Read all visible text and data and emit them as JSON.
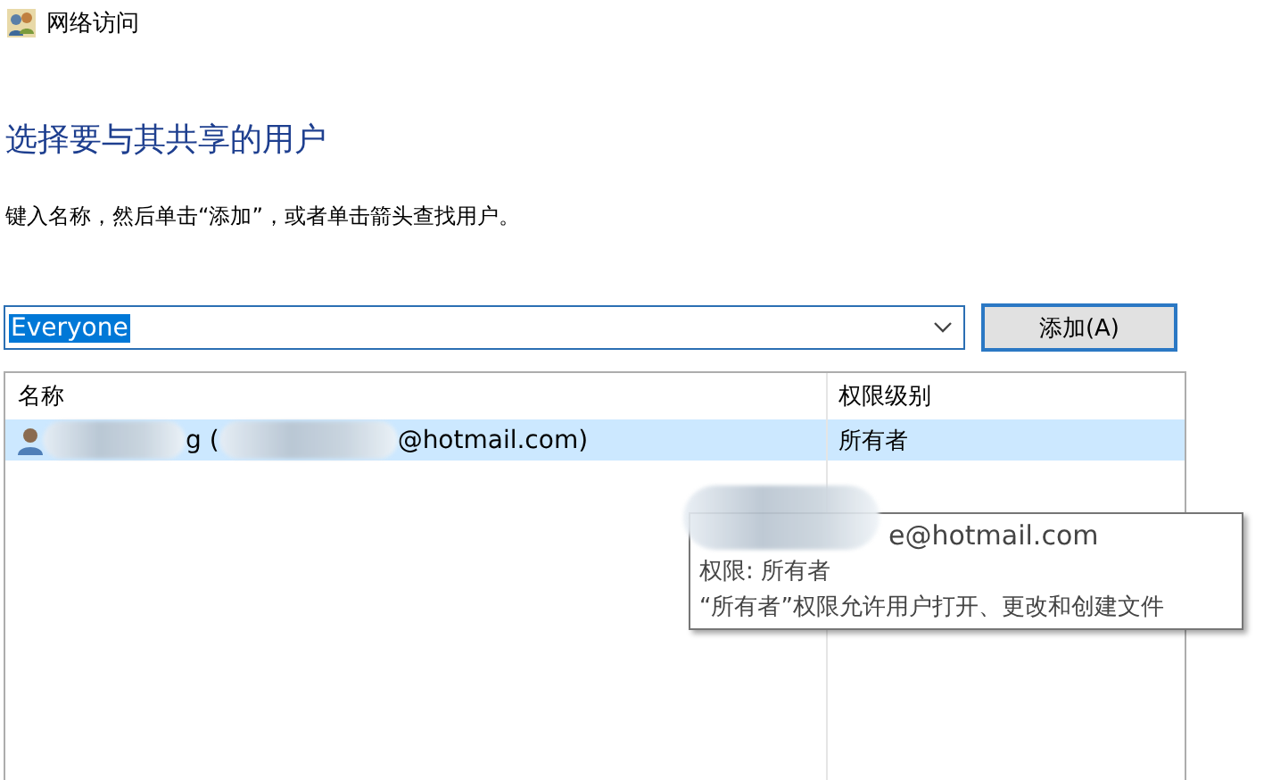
{
  "window": {
    "title": "网络访问"
  },
  "heading": "选择要与其共享的用户",
  "instruction": "键入名称，然后单击“添加”，或者单击箭头查找用户。",
  "name_field": {
    "value": "Everyone"
  },
  "add_button": "添加(A)",
  "table": {
    "columns": [
      "名称",
      "权限级别"
    ],
    "rows": [
      {
        "name_parts": [
          "g (",
          "@hotmail.com)"
        ],
        "permission": "所有者",
        "selected": true
      }
    ]
  },
  "tooltip": {
    "lines": [
      "e@hotmail.com",
      "权限: 所有者",
      "“所有者”权限允许用户打开、更改和创建文件"
    ]
  }
}
